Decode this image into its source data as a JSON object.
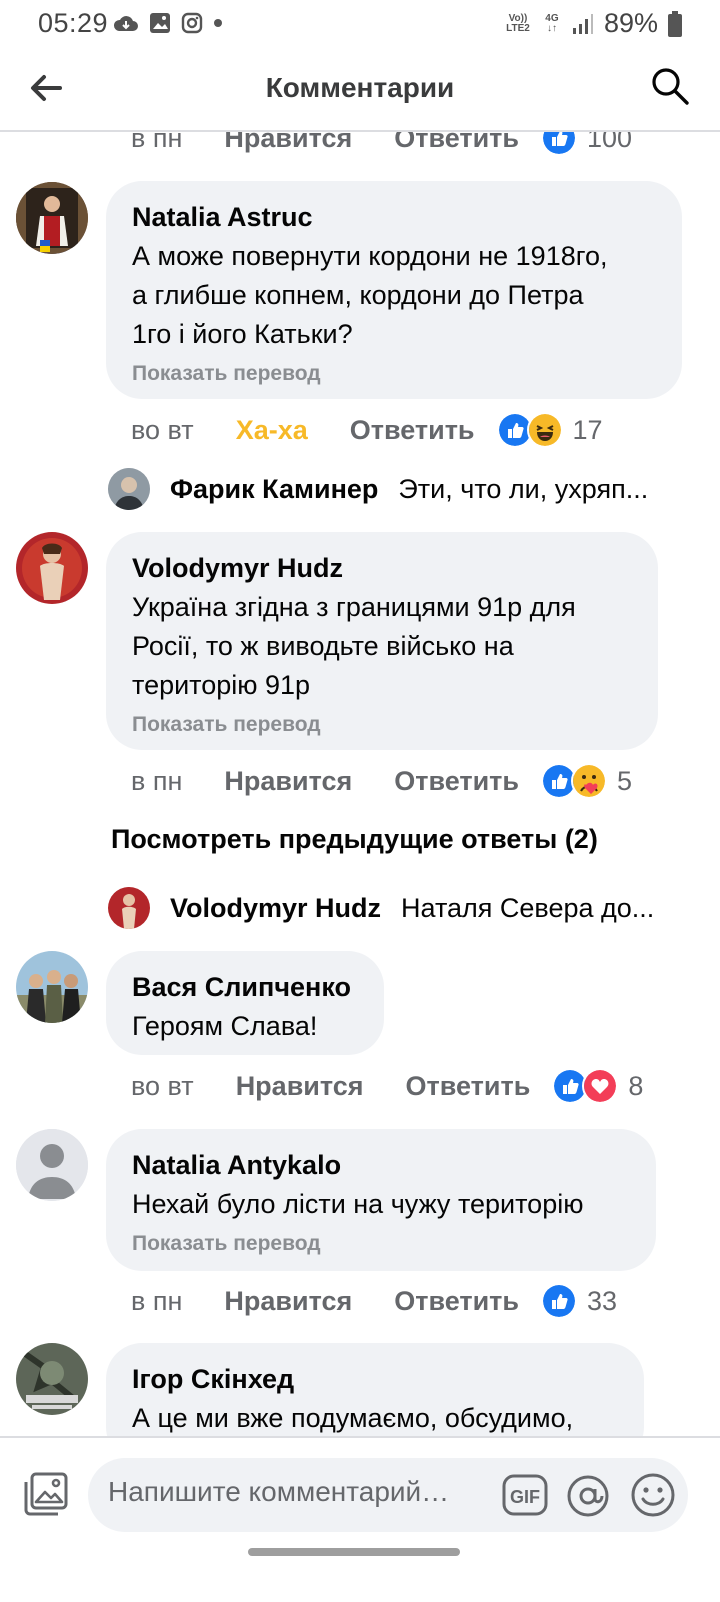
{
  "status_bar": {
    "time": "05:29",
    "network_top": "Vo)) LTE2",
    "network_4g": "4G",
    "battery": "89%"
  },
  "header": {
    "title": "Комментарии"
  },
  "top_partial_actions": {
    "time": "в пн",
    "like": "Нравится",
    "reply": "Ответить",
    "count": "100"
  },
  "comments": [
    {
      "name": "Natalia Astruc",
      "lines": [
        "А може повернути кордони не 1918го,",
        "а глибше копнем, кордони до Петра",
        "1го і його Катьки?"
      ],
      "translate": "Показать перевод",
      "time": "во вт",
      "like": "Ха-ха",
      "reply": "Ответить",
      "count": "17",
      "reply_preview": {
        "name": "Фарик Каминер",
        "text": "Эти, что ли, ухряп..."
      }
    },
    {
      "name": "Volodymyr Hudz",
      "lines": [
        "Україна згідна з границями 91р для",
        "Росії, то ж виводьте військо на",
        "територію 91р"
      ],
      "translate": "Показать перевод",
      "time": "в пн",
      "like": "Нравится",
      "reply": "Ответить",
      "count": "5",
      "view_previous": "Посмотреть предыдущие ответы (2)",
      "reply_preview": {
        "name": "Volodymyr Hudz",
        "text": "Наталя Севера до..."
      }
    },
    {
      "name": "Вася Слипченко",
      "lines": [
        "Героям Слава!"
      ],
      "time": "во вт",
      "like": "Нравится",
      "reply": "Ответить",
      "count": "8"
    },
    {
      "name": "Natalia Antykalo",
      "lines": [
        "Нехай було лісти на чужу територію"
      ],
      "translate": "Показать перевод",
      "time": "в пн",
      "like": "Нравится",
      "reply": "Ответить",
      "count": "33"
    },
    {
      "name": "Ігор Скінхед",
      "lines": [
        "А це ми вже подумаємо, обсудимо,"
      ]
    }
  ],
  "composer": {
    "placeholder": "Напишите комментарий…",
    "gif": "GIF"
  },
  "colors": {
    "like_blue": "#1877f2",
    "love_red": "#f33e58",
    "haha_yellow": "#f7b928",
    "bubble": "#f0f2f5"
  }
}
